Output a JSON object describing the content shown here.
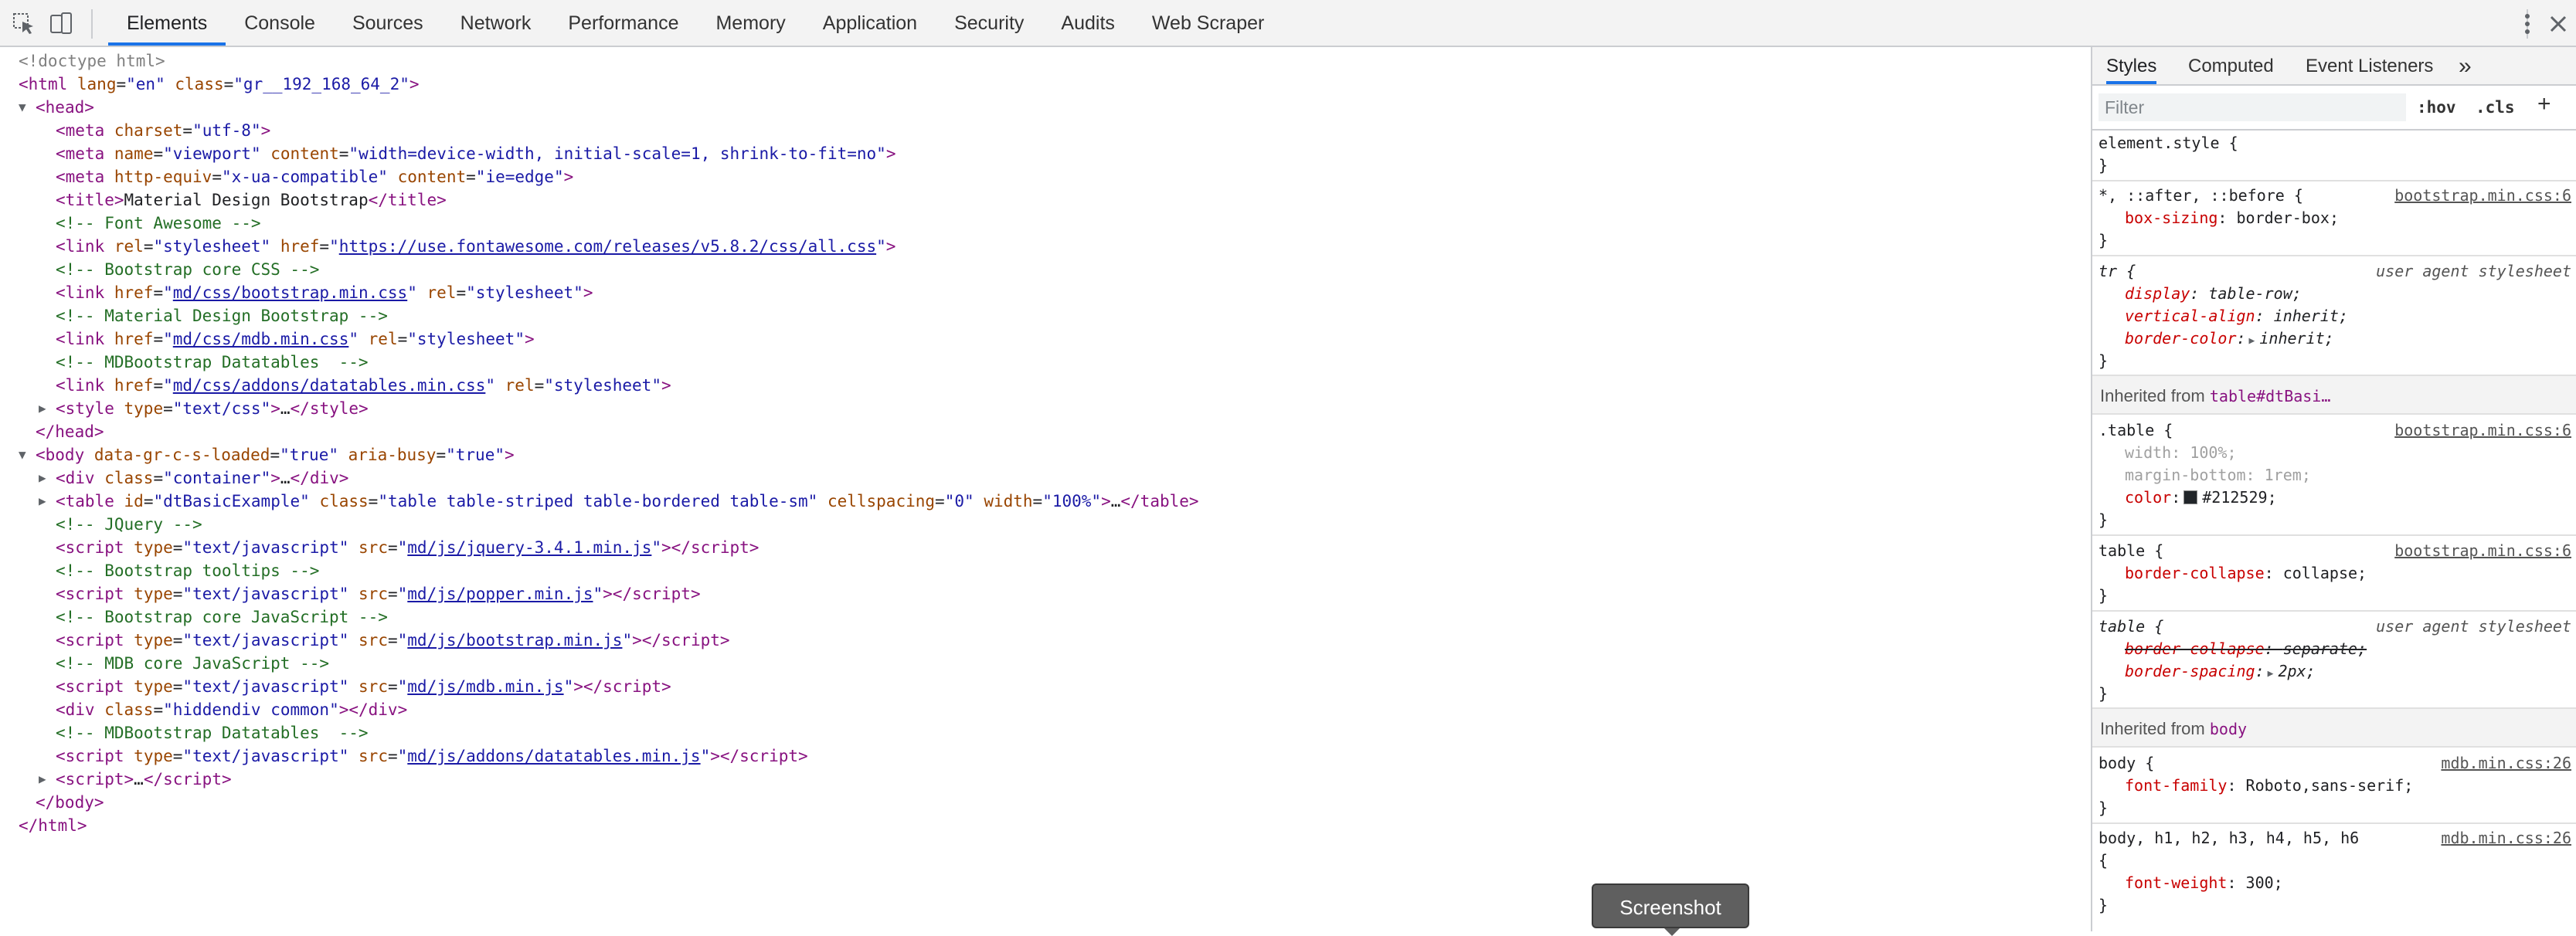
{
  "toolbar": {
    "tabs": [
      "Elements",
      "Console",
      "Sources",
      "Network",
      "Performance",
      "Memory",
      "Application",
      "Security",
      "Audits",
      "Web Scraper"
    ],
    "active_tab": "Elements"
  },
  "dom": {
    "doctype": "<!doctype html>",
    "html_open": {
      "tag": "html",
      "attrs": [
        [
          "lang",
          "en"
        ],
        [
          "class",
          "gr__192_168_64_2"
        ]
      ]
    },
    "head_open": "head",
    "meta_charset": {
      "tag": "meta",
      "attrs": [
        [
          "charset",
          "utf-8"
        ]
      ]
    },
    "meta_viewport": {
      "tag": "meta",
      "attrs": [
        [
          "name",
          "viewport"
        ],
        [
          "content",
          "width=device-width, initial-scale=1, shrink-to-fit=no"
        ]
      ]
    },
    "meta_compat": {
      "tag": "meta",
      "attrs": [
        [
          "http-equiv",
          "x-ua-compatible"
        ],
        [
          "content",
          "ie=edge"
        ]
      ]
    },
    "title_text": "Material Design Bootstrap",
    "comment_fa": "<!-- Font Awesome -->",
    "link_fa_href": "https://use.fontawesome.com/releases/v5.8.2/css/all.css",
    "comment_bs": "<!-- Bootstrap core CSS -->",
    "link_bs_href": "md/css/bootstrap.min.css",
    "comment_mdb": "<!-- Material Design Bootstrap -->",
    "link_mdb_href": "md/css/mdb.min.css",
    "comment_dt": "<!-- MDBootstrap Datatables  -->",
    "link_dt_href": "md/css/addons/datatables.min.css",
    "style_type": "text/css",
    "body_attrs": [
      [
        "data-gr-c-s-loaded",
        "true"
      ],
      [
        "aria-busy",
        "true"
      ]
    ],
    "div_container_class": "container",
    "table_attrs": [
      [
        "id",
        "dtBasicExample"
      ],
      [
        "class",
        "table table-striped table-bordered table-sm"
      ],
      [
        "cellspacing",
        "0"
      ],
      [
        "width",
        "100%"
      ]
    ],
    "comment_jq": "<!-- JQuery -->",
    "script_jq_src": "md/js/jquery-3.4.1.min.js",
    "comment_tt": "<!-- Bootstrap tooltips -->",
    "script_popper_src": "md/js/popper.min.js",
    "comment_bsjs": "<!-- Bootstrap core JavaScript -->",
    "script_bs_src": "md/js/bootstrap.min.js",
    "comment_mdbjs": "<!-- MDB core JavaScript -->",
    "script_mdb_src": "md/js/mdb.min.js",
    "hiddendiv_class": "hiddendiv common",
    "comment_dt2": "<!-- MDBootstrap Datatables  -->",
    "script_dt_src": "md/js/addons/datatables.min.js",
    "script_type": "text/javascript",
    "ellipsis": "…"
  },
  "sidebar": {
    "tabs": [
      "Styles",
      "Computed",
      "Event Listeners"
    ],
    "more": "»",
    "filter_placeholder": "Filter",
    "hov": ":hov",
    "cls": ".cls",
    "plus": "+",
    "rules": {
      "element_style": "element.style {",
      "universal_sel": "*, ::after, ::before {",
      "universal_src": "bootstrap.min.css:6",
      "universal_prop": "box-sizing",
      "universal_val": "border-box",
      "tr_sel": "tr {",
      "tr_src": "user agent stylesheet",
      "tr_p1": "display",
      "tr_v1": "table-row",
      "tr_p2": "vertical-align",
      "tr_v2": "inherit",
      "tr_p3": "border-color",
      "tr_v3": "inherit",
      "inherit_table_label": "Inherited from",
      "inherit_table_name": "table#dtBasi…",
      "dottable_sel": ".table {",
      "dottable_src": "bootstrap.min.css:6",
      "dottable_p1": "width",
      "dottable_v1": "100%",
      "dottable_p2": "margin-bottom",
      "dottable_v2": "1rem",
      "dottable_p3": "color",
      "dottable_v3": "#212529",
      "table1_sel": "table {",
      "table1_src": "bootstrap.min.css:6",
      "table1_p": "border-collapse",
      "table1_v": "collapse",
      "table2_sel": "table {",
      "table2_src": "user agent stylesheet",
      "table2_p1": "border-collapse",
      "table2_v1": "separate",
      "table2_p2": "border-spacing",
      "table2_v2": "2px",
      "inherit_body_label": "Inherited from",
      "inherit_body_name": "body",
      "body_sel": "body {",
      "body_src": "mdb.min.css:26",
      "body_p": "font-family",
      "body_v": "Roboto,sans-serif",
      "bodyh_sel": "body, h1, h2, h3, h4, h5, h6",
      "bodyh_src": "mdb.min.css:26",
      "bodyh_p": "font-weight",
      "bodyh_v": "300",
      "brace_open": "{",
      "brace_close": "}"
    }
  },
  "tooltip": "Screenshot",
  "colors": {
    "accent": "#1a73e8",
    "tag": "#881280",
    "attr": "#994500",
    "value": "#1a1aa6",
    "comment": "#236e25",
    "prop": "#c80000"
  }
}
